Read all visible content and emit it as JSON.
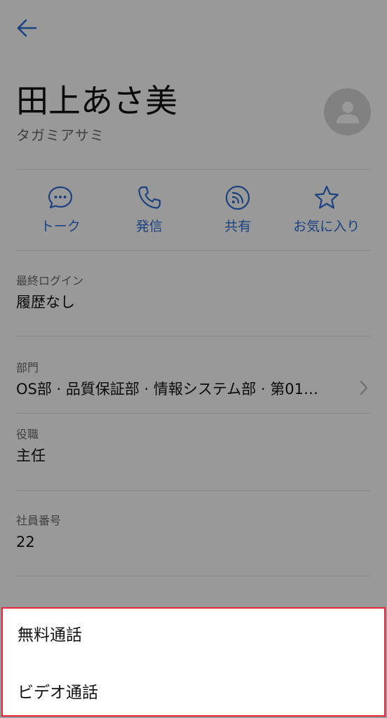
{
  "header": {
    "back_icon": "arrow-left-icon"
  },
  "profile": {
    "name": "田上あさ美",
    "kana": "タガミアサミ",
    "avatar_icon": "person-icon"
  },
  "actions": [
    {
      "label": "トーク",
      "icon": "chat-bubble-icon"
    },
    {
      "label": "発信",
      "icon": "phone-icon"
    },
    {
      "label": "共有",
      "icon": "share-icon"
    },
    {
      "label": "お気に入り",
      "icon": "star-icon"
    }
  ],
  "fields": {
    "last_login": {
      "label": "最終ログイン",
      "value": "履歴なし"
    },
    "department": {
      "label": "部門",
      "value": "OS部 · 品質保証部 · 情報システム部 · 第01…"
    },
    "position": {
      "label": "役職",
      "value": "主任"
    },
    "employee_no": {
      "label": "社員番号",
      "value": "22"
    }
  },
  "sheet": {
    "items": [
      {
        "label": "無料通話"
      },
      {
        "label": "ビデオ通話"
      }
    ]
  },
  "colors": {
    "accent": "#2f6fd6",
    "highlight_border": "#e8263a",
    "overlay": "rgba(0,0,0,0.4)"
  }
}
